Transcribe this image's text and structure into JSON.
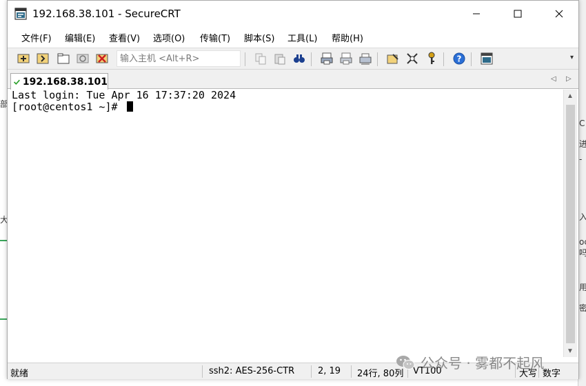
{
  "window": {
    "title": "192.168.38.101 - SecureCRT"
  },
  "menu": {
    "items": [
      "文件(F)",
      "编辑(E)",
      "查看(V)",
      "选项(O)",
      "传输(T)",
      "脚本(S)",
      "工具(L)",
      "帮助(H)"
    ]
  },
  "toolbar": {
    "host_placeholder": "输入主机 <Alt+R>",
    "icons": [
      "connect-icon",
      "quick-connect-icon",
      "connect-tab-icon",
      "reconnect-icon",
      "disconnect-icon",
      "copy-icon",
      "paste-icon",
      "find-icon",
      "print-icon",
      "print-selection-icon",
      "print-setup-icon",
      "session-options-icon",
      "global-options-icon",
      "key-icon",
      "help-icon",
      "about-icon"
    ]
  },
  "tabs": {
    "active_label": "192.168.38.101"
  },
  "terminal": {
    "lines": [
      "Last login: Tue Apr 16 17:37:20 2024",
      "[root@centos1 ~]# "
    ]
  },
  "status": {
    "ready": "就绪",
    "cipher": "ssh2: AES-256-CTR",
    "position": "2, 19",
    "size": "24行, 80列",
    "emulation": "VT100",
    "caps": "大写",
    "num": "数字"
  },
  "watermark": {
    "text": "公众号 · 雾都不起风"
  },
  "background_fragments": {
    "right": [
      "C",
      "进",
      "-",
      "入",
      "oc",
      "吗",
      "用",
      "密"
    ],
    "left": [
      "部",
      "大"
    ]
  },
  "colors": {
    "accent_green": "#2aa02a",
    "scroll_thumb": "#cdcdcd",
    "chrome": "#f0f0f0"
  }
}
